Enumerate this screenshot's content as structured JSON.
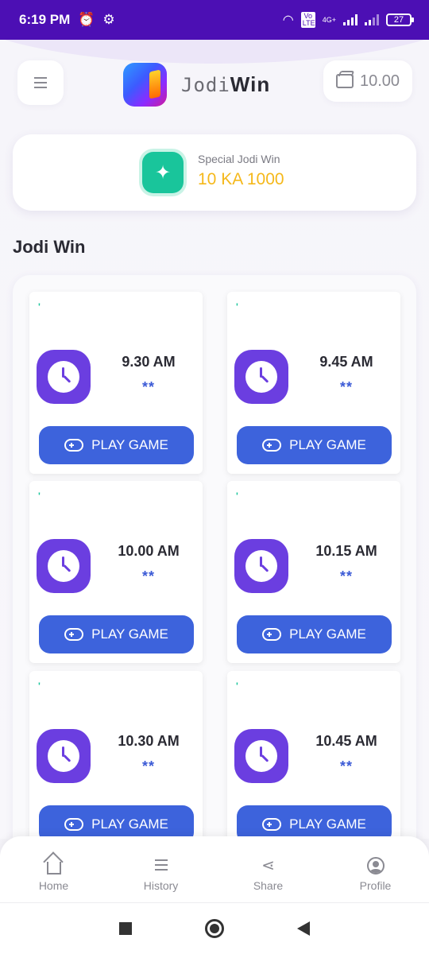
{
  "status_bar": {
    "time": "6:19 PM",
    "network": "4G+",
    "volte": "Vo LTE",
    "battery": "27"
  },
  "header": {
    "brand_part1": "Jodi",
    "brand_part2": "Win",
    "wallet_balance": "10.00"
  },
  "special": {
    "label": "Special Jodi Win",
    "value": "10 KA 1000"
  },
  "section_title": "Jodi Win",
  "games": [
    {
      "time": "9.30 AM",
      "result": "**",
      "button": "PLAY GAME"
    },
    {
      "time": "9.45 AM",
      "result": "**",
      "button": "PLAY GAME"
    },
    {
      "time": "10.00 AM",
      "result": "**",
      "button": "PLAY GAME"
    },
    {
      "time": "10.15 AM",
      "result": "**",
      "button": "PLAY GAME"
    },
    {
      "time": "10.30 AM",
      "result": "**",
      "button": "PLAY GAME"
    },
    {
      "time": "10.45 AM",
      "result": "**",
      "button": "PLAY GAME"
    }
  ],
  "bottom_nav": [
    {
      "label": "Home",
      "icon": "home-icon"
    },
    {
      "label": "History",
      "icon": "history-icon"
    },
    {
      "label": "Share",
      "icon": "share-icon"
    },
    {
      "label": "Profile",
      "icon": "profile-icon"
    }
  ],
  "colors": {
    "status_bar": "#4c0fb4",
    "accent_purple": "#6b3ee0",
    "play_button": "#3d63dc",
    "special_value": "#f5b81a",
    "spark_green": "#19c59b"
  }
}
